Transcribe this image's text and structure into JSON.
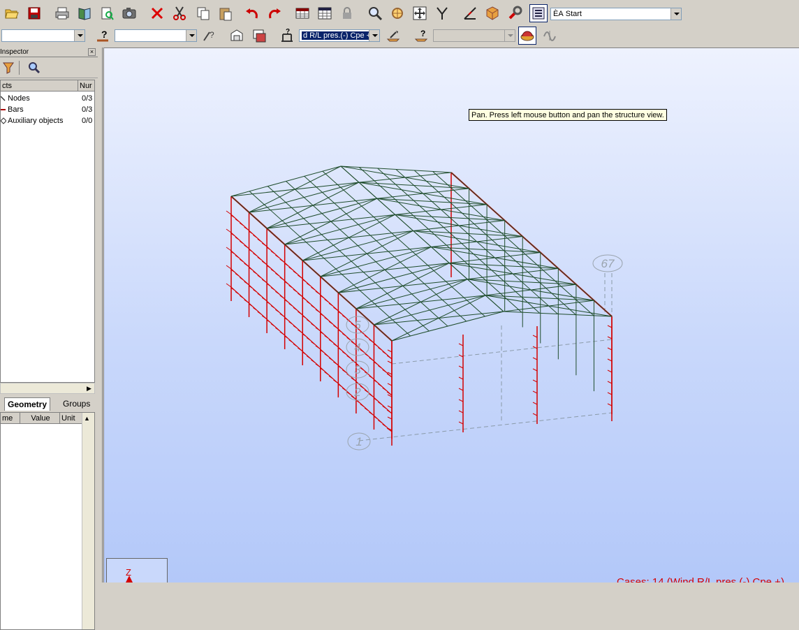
{
  "toolbar1": {
    "icons": [
      "open-icon",
      "save-icon",
      "print-icon",
      "print-preview-icon",
      "screen-capture-report-icon",
      "camera-icon",
      "delete-icon",
      "cut-icon",
      "copy-icon",
      "paste-icon",
      "undo-icon",
      "redo-icon",
      "table-icon",
      "table-edit-icon",
      "lock-icon",
      "zoom-icon",
      "zoom-window-icon",
      "pan-icon",
      "select-icon",
      "section-icon",
      "3d-view-icon",
      "tools-icon",
      "layout-selector-icon"
    ],
    "layout_combo": "ЀА Start"
  },
  "toolbar2": {
    "combo1": "",
    "combo2": "",
    "load_case_combo": "d R/L pres.(-) Cpe +",
    "disabled_combo": ""
  },
  "inspector": {
    "title": "Inspector",
    "close": "×",
    "columns": {
      "objects": "cts",
      "number": "Nur"
    },
    "rows": [
      {
        "label": "Nodes",
        "count": "0/3"
      },
      {
        "label": "Bars",
        "count": "0/3"
      },
      {
        "label": "Auxiliary objects",
        "count": "0/0"
      }
    ],
    "tabs": {
      "geometry": "Geometry",
      "groups": "Groups"
    },
    "props_columns": {
      "name": "me",
      "value": "Value",
      "unit": "Unit"
    }
  },
  "viewport": {
    "tooltip": "Pan. Press left mouse button and pan the structure view.",
    "axis_label": "Z",
    "case_label": "Cases: 14 (Wind R/L pres.(-) Cpe +)",
    "grid_labels": [
      "1",
      "67",
      "5",
      "4",
      "3",
      "2"
    ]
  },
  "colors": {
    "frame": "#1f4d2c",
    "bars_red": "#d40000",
    "background_top": "#eef2fe",
    "background_bottom": "#b3c8f9"
  }
}
